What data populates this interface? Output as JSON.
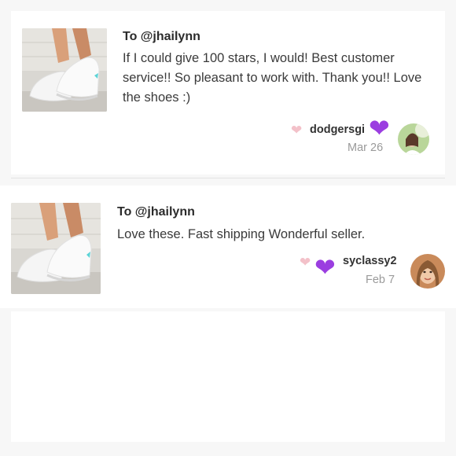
{
  "reviews": [
    {
      "to": "To @jhailynn",
      "message": "If I could give 100 stars, I would! Best customer service!! So pleasant to work with. Thank you!! Love the shoes :)",
      "username": "dodgersgi",
      "date": "Mar 26",
      "heart_icon": "heart-icon",
      "emoji_icon": "purple-heart-emoji"
    },
    {
      "to": "To @jhailynn",
      "message": "Love these. Fast shipping Wonderful seller.",
      "username": "syclassy2",
      "date": "Feb 7",
      "heart_icon": "heart-icon",
      "emoji_icon": "purple-heart-emoji"
    }
  ],
  "colors": {
    "heart": "#f3c1c9",
    "purple_heart": "#9b3ee0",
    "date": "#9a9a9a"
  }
}
